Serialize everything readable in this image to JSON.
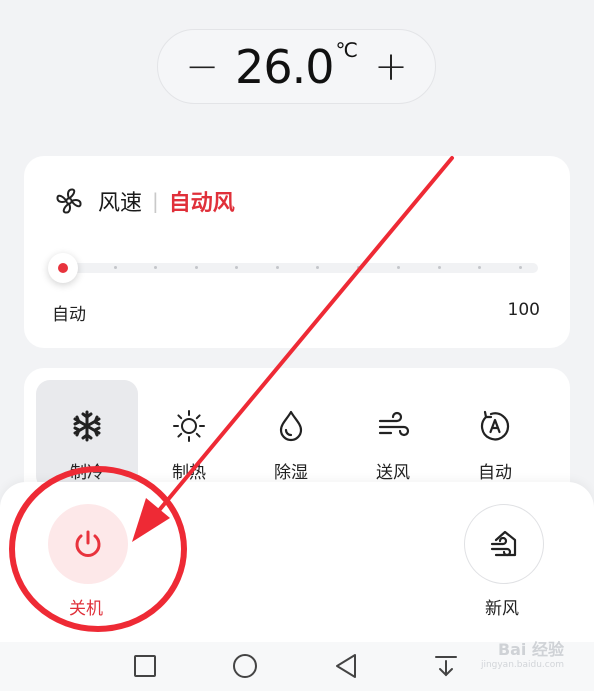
{
  "temperature": {
    "decrease_label": "−",
    "value": "26.0",
    "unit": "℃",
    "increase_label": "+"
  },
  "fan_speed": {
    "icon": "fan-icon",
    "title": "风速",
    "separator": "|",
    "mode": "自动风",
    "slider_min_label": "自动",
    "slider_max_label": "100",
    "level": 0
  },
  "modes": {
    "items": [
      {
        "label": "制冷",
        "icon": "snowflake-icon",
        "active": true
      },
      {
        "label": "制热",
        "icon": "sun-icon",
        "active": false
      },
      {
        "label": "除湿",
        "icon": "droplet-icon",
        "active": false
      },
      {
        "label": "送风",
        "icon": "wind-icon",
        "active": false
      },
      {
        "label": "自动",
        "icon": "auto-mode-icon",
        "active": false
      }
    ]
  },
  "actions": {
    "power_label": "关机",
    "fresh_air_label": "新风"
  },
  "watermark": {
    "text": "Bai 经验",
    "sub": "jingyan.baidu.com"
  },
  "colors": {
    "accent": "#e0303a",
    "annotation": "#ee2a35"
  }
}
